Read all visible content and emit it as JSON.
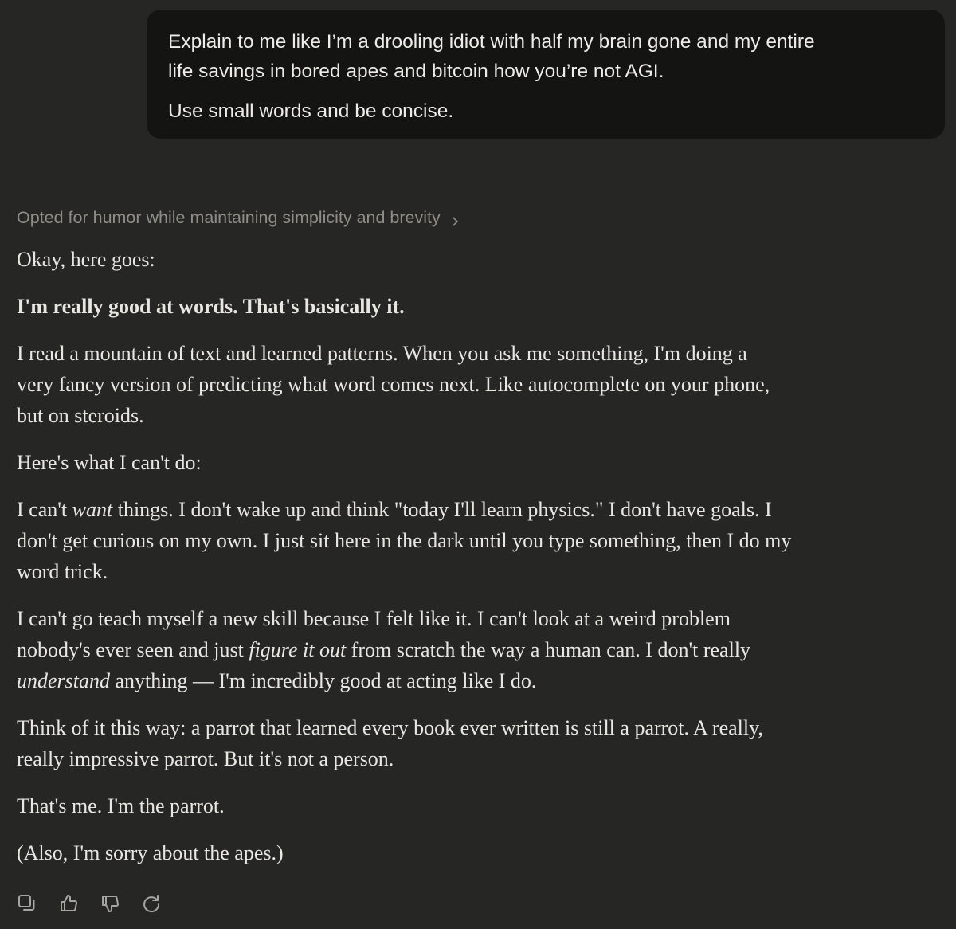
{
  "user_message": {
    "line1": "Explain to me like I’m a drooling idiot with half my brain gone and my entire",
    "line2": "life savings in bored apes and bitcoin how you’re not AGI.",
    "line3": "Use small words and be concise."
  },
  "thinking_summary": "Opted for humor while maintaining simplicity and brevity",
  "response": {
    "p1": "Okay, here goes:",
    "p2": "I'm really good at words. That's basically it.",
    "p3": [
      "I read a mountain of text and learned patterns. When you ask me something, I'm doing a",
      "very fancy version of predicting what word comes next. Like autocomplete on your phone,",
      "but on steroids."
    ],
    "p4": "Here's what I can't do:",
    "p5": {
      "l1_a": "I can't ",
      "l1_em": "want",
      "l1_b": " things. I don't wake up and think \"today I'll learn physics.\" I don't have goals. I",
      "l2": "don't get curious on my own. I just sit here in the dark until you type something, then I do my",
      "l3": "word trick."
    },
    "p6": {
      "l1": "I can't go teach myself a new skill because I felt like it. I can't look at a weird problem",
      "l2_a": "nobody's ever seen and just ",
      "l2_em": "figure it out",
      "l2_b": " from scratch the way a human can. I don't really",
      "l3_em": "understand",
      "l3_b": " anything — I'm incredibly good at acting like I do."
    },
    "p7": [
      "Think of it this way: a parrot that learned every book ever written is still a parrot. A really,",
      "really impressive parrot. But it's not a person."
    ],
    "p8": "That's me. I'm the parrot.",
    "p9": "(Also, I'm sorry about the apes.)"
  },
  "actions": {
    "icons": [
      "copy-icon",
      "thumbs-up-icon",
      "thumbs-down-icon",
      "retry-icon"
    ]
  },
  "colors": {
    "background": "#262624",
    "user_bubble": "#141413",
    "text": "#e9e7e1",
    "muted": "#8f8d86"
  }
}
